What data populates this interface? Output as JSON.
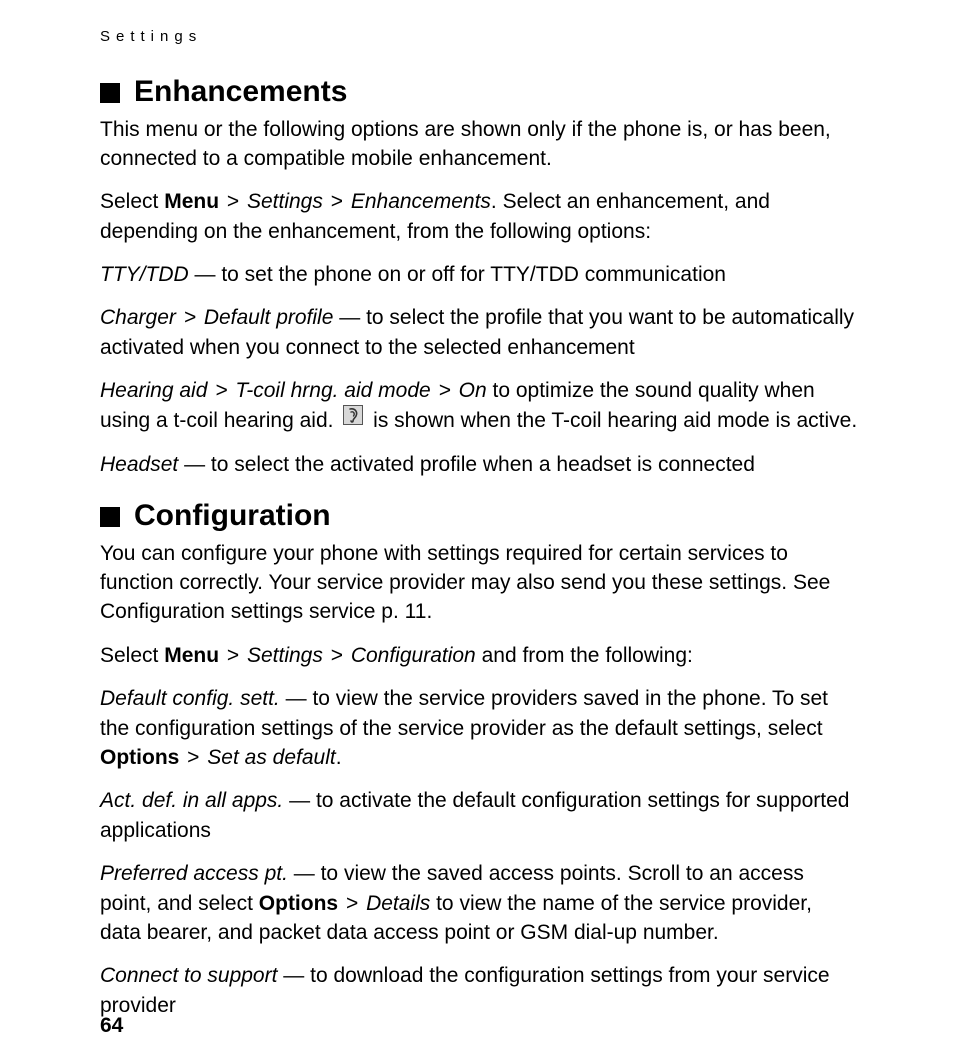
{
  "runningHead": "Settings",
  "pageNumber": "64",
  "gt": ">",
  "dash": "—",
  "enhance": {
    "title": "Enhancements",
    "intro": "This menu or the following options are shown only if the phone is, or has been, connected to a compatible mobile enhancement.",
    "nav_prefix": "Select ",
    "menu": "Menu",
    "settings": "Settings",
    "enh": "Enhancements",
    "nav_suffix": ". Select an enhancement, and depending on the enhancement, from the following options:",
    "tty_term": "TTY/TDD",
    "tty_text": " to set the phone on or off for TTY/TDD communication",
    "charger_term": "Charger",
    "charger_sub": "Default profile",
    "charger_text": " to select the profile that you want to be automatically activated when you connect to the selected enhancement",
    "hearing_term": "Hearing aid",
    "hearing_sub1": "T-coil hrng. aid mode",
    "hearing_sub2": "On",
    "hearing_text1": " to optimize the sound quality when using a t-coil hearing aid. ",
    "hearing_text2": " is shown when the T-coil hearing aid mode is active.",
    "headset_term": "Headset",
    "headset_text": " to select the activated profile when a headset is connected"
  },
  "config": {
    "title": "Configuration",
    "intro": "You can configure your phone with settings required for certain services to function correctly. Your service provider may also send you these settings. See Configuration settings service p. 11.",
    "nav_prefix": "Select ",
    "menu": "Menu",
    "settings": "Settings",
    "conf": "Configuration",
    "nav_suffix": " and from the following:",
    "def_term": "Default config. sett.",
    "def_text": " to view the service providers saved in the phone. To set the configuration settings of the service provider as the default settings, select ",
    "def_opt": "Options",
    "def_setdef": "Set as default",
    "dot": ".",
    "act_term": "Act. def. in all apps.",
    "act_text": " to activate the default configuration settings for supported applications",
    "pref_term": "Preferred access pt.",
    "pref_text1": " to view the saved access points. Scroll to an access point, and select ",
    "pref_opt": "Options",
    "pref_details": "Details",
    "pref_text2": " to view the name of the service provider, data bearer, and packet data access point or GSM dial-up number.",
    "conn_term": "Connect to support",
    "conn_text": " to download the configuration settings from your service provider"
  }
}
